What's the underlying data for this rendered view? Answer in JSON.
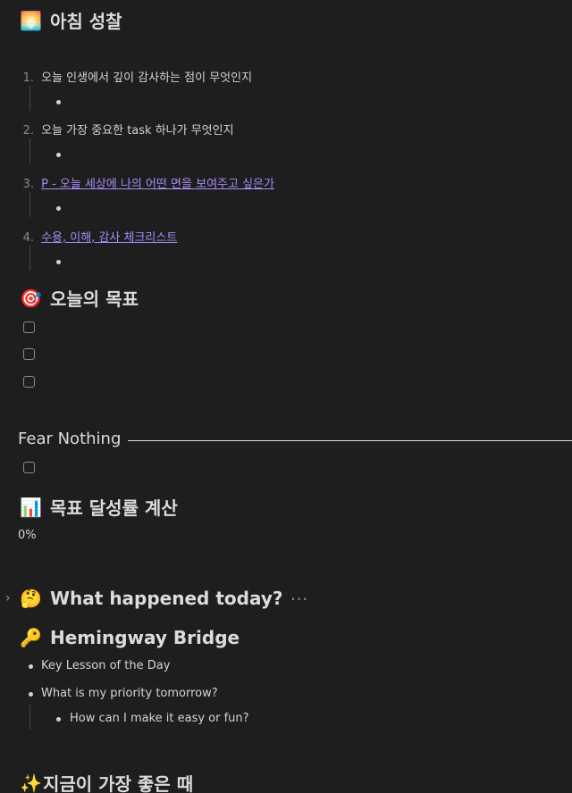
{
  "sections": {
    "morning": {
      "icon": "sunrise-icon",
      "emoji": "🌅",
      "title": "아침 성찰"
    },
    "goals": {
      "icon": "dart-icon",
      "emoji": "🎯",
      "title": "오늘의 목표"
    },
    "rate": {
      "icon": "bar-chart-icon",
      "emoji": "📊",
      "title": "목표 달성률 계산",
      "value": "0%"
    },
    "happened": {
      "icon": "thinking-face-icon",
      "emoji": "🤔",
      "title": "What happened today?",
      "more": "⋯",
      "toggle": "›"
    },
    "bridge": {
      "icon": "key-icon",
      "emoji": "🔑",
      "title": "Hemingway Bridge"
    },
    "best": {
      "icon": "sparkles-icon",
      "emoji": "✨",
      "title": "지금이 가장 좋은 때"
    }
  },
  "morning_list": [
    {
      "num": "1.",
      "text": "오늘 인생에서 깊이 감사하는 점이 무엇인지"
    },
    {
      "num": "2.",
      "text": "오늘 가장 중요한 task 하나가 무엇인지"
    },
    {
      "num": "3.",
      "text": "P - 오늘 세상에 나의 어떤 면을 보여주고 싶은가"
    },
    {
      "num": "4.",
      "text": "수용, 이해, 감사 체크리스트"
    }
  ],
  "fear_nothing": {
    "title": "Fear Nothing"
  },
  "bridge_list": {
    "item1": "Key Lesson of the Day",
    "item2": "What is my priority tomorrow?",
    "sub1": "How can I make it easy or fun?"
  },
  "colors": {
    "background": "#1e1e1e",
    "text": "#d4d4d4",
    "link": "#a78bfa",
    "muted": "#8a8a8a"
  }
}
